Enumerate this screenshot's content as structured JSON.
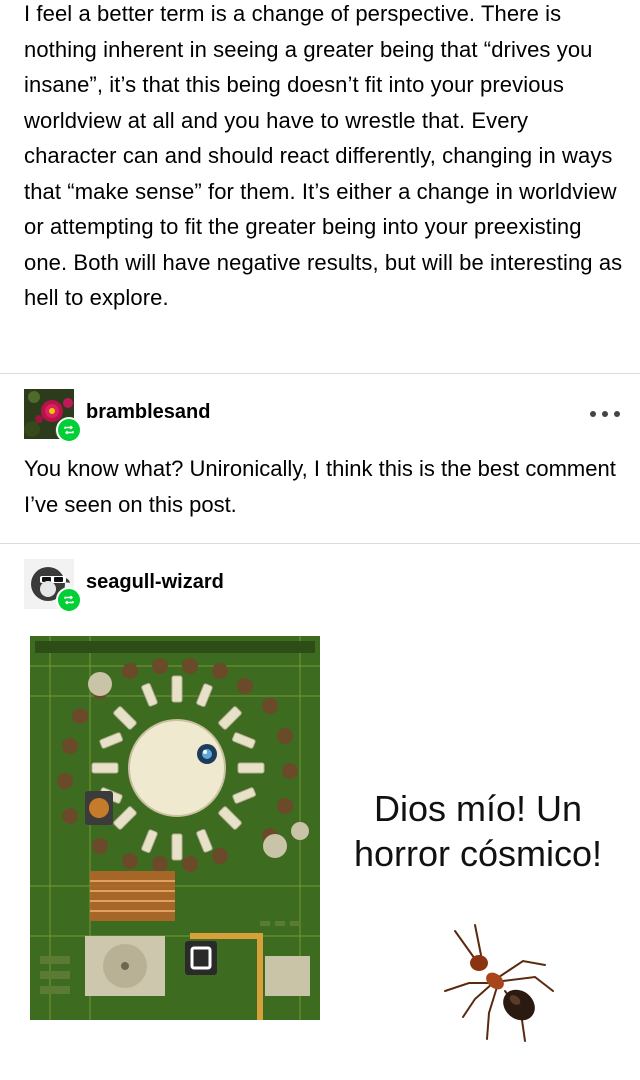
{
  "original_post": {
    "text": "I feel a better term is a change of perspective. There is nothing inherent in seeing a greater being that “drives you insane”, it’s that this being doesn’t fit into your previous worldview at all and you have to wrestle that. Every character can and should react differently, changing in ways that “make sense” for them. It’s either a change in worldview or attempting to fit the greater being into your preexisting one. Both will have negative results, but will be interesting as hell to explore."
  },
  "reblogs": [
    {
      "username": "bramblesand",
      "avatar_icon": "rose-avatar",
      "badge_icon": "reblog-icon",
      "comment": "You know what? Unironically, I think this is the best comment I’ve seen on this post."
    },
    {
      "username": "seagull-wizard",
      "avatar_icon": "seagull-sunglasses-avatar",
      "badge_icon": "reblog-icon",
      "meme_caption": "Dios mío! Un horror cósmico!"
    }
  ],
  "colors": {
    "reblog_badge": "#00cf35",
    "divider": "#dcdcdc",
    "pcb_green": "#3d6b1f"
  }
}
